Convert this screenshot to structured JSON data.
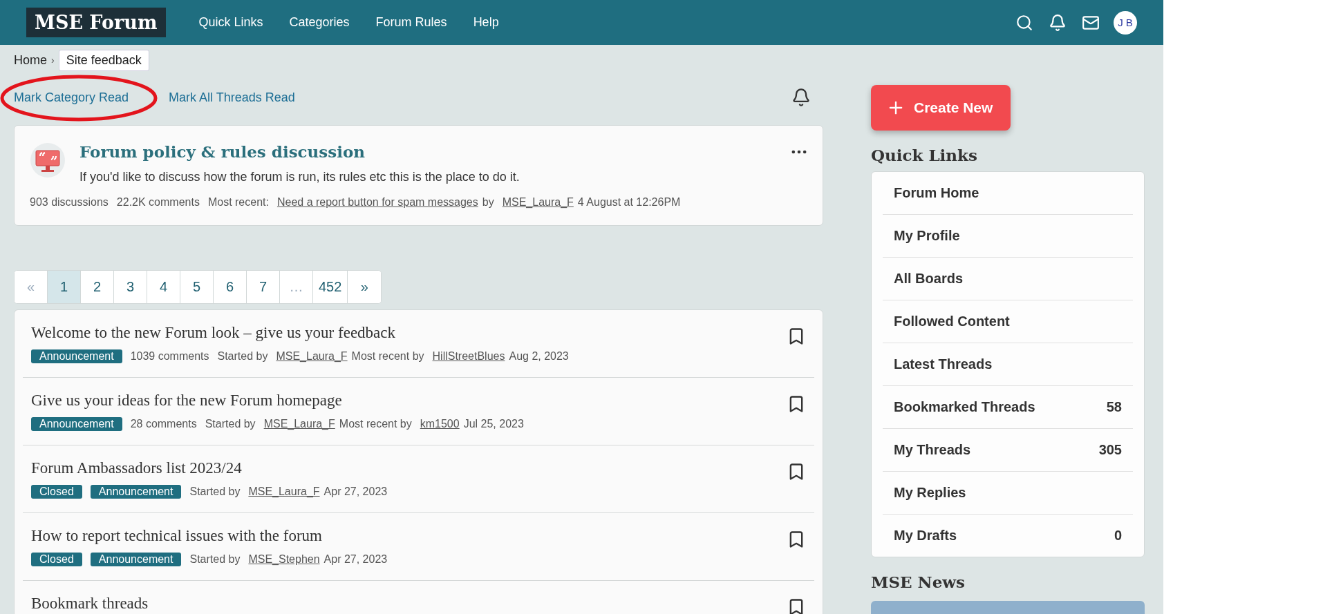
{
  "header": {
    "logo": "MSE Forum",
    "nav": [
      "Quick Links",
      "Categories",
      "Forum Rules",
      "Help"
    ],
    "avatar": "J B"
  },
  "breadcrumb": [
    {
      "label": "Home",
      "current": false
    },
    {
      "label": "Site feedback",
      "current": true
    }
  ],
  "breadcrumb_separator": "›",
  "mark_links": [
    {
      "label": "Mark Category Read",
      "circled": true
    },
    {
      "label": "Mark All Threads Read",
      "circled": false
    }
  ],
  "category": {
    "title": "Forum policy & rules discussion",
    "description": "If you'd like to discuss how the forum is run, its rules etc this is the place to do it.",
    "meta": [
      {
        "kind": "text",
        "text": "903 discussions"
      },
      {
        "kind": "text",
        "text": "22.2K comments"
      },
      {
        "kind": "text",
        "text": "Most recent:"
      },
      {
        "kind": "link",
        "text": "Need a report button for spam messages"
      },
      {
        "kind": "text",
        "text": "by"
      },
      {
        "kind": "link",
        "text": "MSE_Laura_F"
      },
      {
        "kind": "text",
        "text": "4 August at 12:26PM"
      }
    ]
  },
  "pagination": [
    {
      "label": "«",
      "selected": false,
      "disabled": true
    },
    {
      "label": "1",
      "selected": true,
      "disabled": false
    },
    {
      "label": "2",
      "selected": false,
      "disabled": false
    },
    {
      "label": "3",
      "selected": false,
      "disabled": false
    },
    {
      "label": "4",
      "selected": false,
      "disabled": false
    },
    {
      "label": "5",
      "selected": false,
      "disabled": false
    },
    {
      "label": "6",
      "selected": false,
      "disabled": false
    },
    {
      "label": "7",
      "selected": false,
      "disabled": false
    },
    {
      "label": "…",
      "selected": false,
      "disabled": true
    },
    {
      "label": "452",
      "selected": false,
      "disabled": false
    },
    {
      "label": "»",
      "selected": false,
      "disabled": false
    }
  ],
  "threads": [
    {
      "title": "Welcome to the new Forum look – give us your feedback",
      "tags": [
        "Announcement"
      ],
      "meta": [
        {
          "kind": "text",
          "text": "1039 comments"
        },
        {
          "kind": "text",
          "text": "Started by"
        },
        {
          "kind": "link",
          "text": "MSE_Laura_F"
        },
        {
          "kind": "text",
          "text": "Most recent by"
        },
        {
          "kind": "link",
          "text": "HillStreetBlues"
        },
        {
          "kind": "text",
          "text": "Aug 2, 2023"
        }
      ]
    },
    {
      "title": "Give us your ideas for the new Forum homepage",
      "tags": [
        "Announcement"
      ],
      "meta": [
        {
          "kind": "text",
          "text": "28 comments"
        },
        {
          "kind": "text",
          "text": "Started by"
        },
        {
          "kind": "link",
          "text": "MSE_Laura_F"
        },
        {
          "kind": "text",
          "text": "Most recent by"
        },
        {
          "kind": "link",
          "text": "km1500"
        },
        {
          "kind": "text",
          "text": "Jul 25, 2023"
        }
      ]
    },
    {
      "title": "Forum Ambassadors list 2023/24",
      "tags": [
        "Closed",
        "Announcement"
      ],
      "meta": [
        {
          "kind": "text",
          "text": "Started by"
        },
        {
          "kind": "link",
          "text": "MSE_Laura_F"
        },
        {
          "kind": "text",
          "text": "Apr 27, 2023"
        }
      ]
    },
    {
      "title": "How to report technical issues with the forum",
      "tags": [
        "Closed",
        "Announcement"
      ],
      "meta": [
        {
          "kind": "text",
          "text": "Started by"
        },
        {
          "kind": "link",
          "text": "MSE_Stephen"
        },
        {
          "kind": "text",
          "text": "Apr 27, 2023"
        }
      ]
    },
    {
      "title": "Bookmark threads"
    }
  ],
  "sidebar": {
    "create_button": "Create New",
    "quick_links_title": "Quick Links",
    "quick_links": [
      {
        "label": "Forum Home"
      },
      {
        "label": "My Profile"
      },
      {
        "label": "All Boards"
      },
      {
        "label": "Followed Content"
      },
      {
        "label": "Latest Threads"
      },
      {
        "label": "Bookmarked Threads",
        "count": "58"
      },
      {
        "label": "My Threads",
        "count": "305"
      },
      {
        "label": "My Replies"
      },
      {
        "label": "My Drafts",
        "count": "0"
      }
    ],
    "news_title": "MSE News"
  }
}
